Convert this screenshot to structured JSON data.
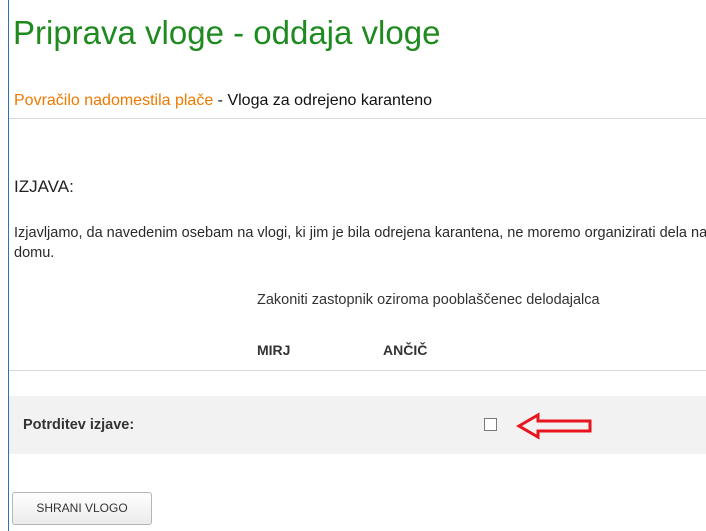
{
  "header": {
    "title": "Priprava vloge - oddaja vloge"
  },
  "subheader": {
    "link_text": "Povračilo nadomestila plače",
    "separator": " - ",
    "rest_text": "Vloga za odrejeno karanteno"
  },
  "declaration": {
    "heading": "IZJAVA:",
    "text": "Izjavljamo, da navedenim osebam na vlogi, ki jim je bila odrejena karantena, ne moremo organizirati dela na domu.",
    "representative_label": "Zakoniti zastopnik oziroma pooblaščenec delodajalca",
    "signatory_first": "MIRJ",
    "signatory_last": "ANČIČ"
  },
  "confirmation": {
    "label": "Potrditev izjave:",
    "checked": false
  },
  "actions": {
    "save_label": "SHRANI VLOGO"
  },
  "colors": {
    "title": "#1f8a1f",
    "link": "#f07800",
    "annotation_arrow": "#e8141e"
  },
  "icons": {
    "annotation": "red-arrow-left-icon"
  }
}
